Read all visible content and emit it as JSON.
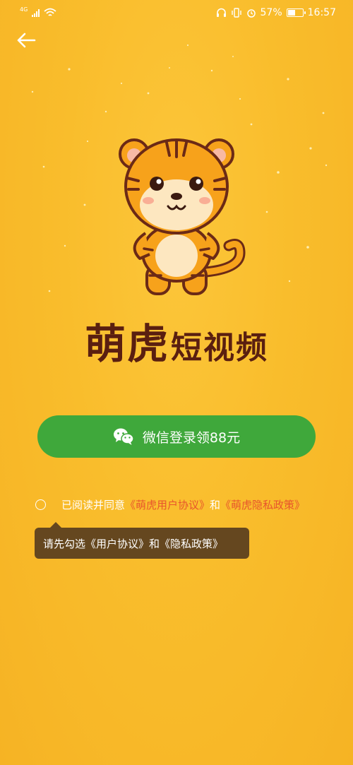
{
  "status_bar": {
    "network": "4G",
    "battery": "57%",
    "battery_level": 0.57,
    "time": "16:57"
  },
  "header": {
    "back_icon": "arrow-left-icon"
  },
  "app": {
    "title_part1": "萌虎",
    "title_part2": "短视频"
  },
  "login": {
    "wechat_label": "微信登录领88元",
    "wechat_icon": "wechat-icon",
    "button_color": "#3fa83b"
  },
  "agreement": {
    "prefix": "已阅读并同意",
    "user_agreement": "《萌虎用户协议》",
    "connector": "和",
    "privacy_policy": "《萌虎隐私政策》",
    "link_color": "#e8552c"
  },
  "tooltip": {
    "text": "请先勾选《用户协议》和《隐私政策》"
  }
}
